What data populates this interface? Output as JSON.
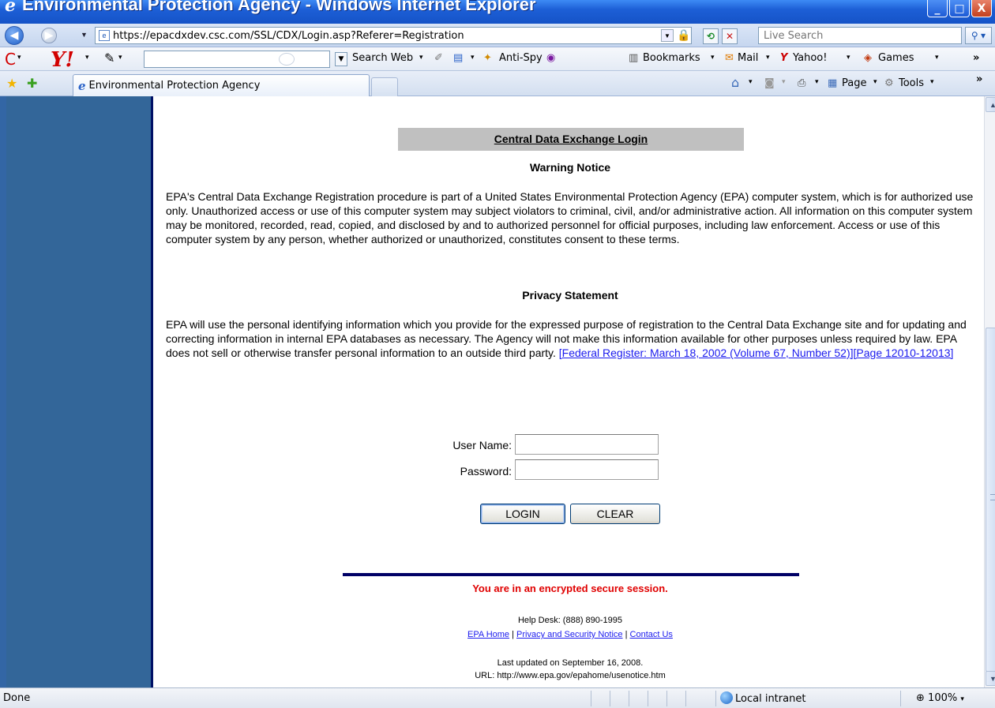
{
  "window": {
    "title": "Environmental Protection Agency - Windows Internet Explorer",
    "buttons": {
      "minimize": "_",
      "maximize": "□",
      "close": "X"
    }
  },
  "address_bar": {
    "url": "https://epacdxdev.csc.com/SSL/CDX/Login.asp?Referer=Registration",
    "search_placeholder": "Live Search"
  },
  "yahoo_toolbar": {
    "search_web_label": "Search Web",
    "anti_spy_label": "Anti-Spy",
    "bookmarks_label": "Bookmarks",
    "mail_label": "Mail",
    "yahoo_label": "Yahoo!",
    "games_label": "Games",
    "more": "»"
  },
  "tabs": {
    "active_label": "Environmental Protection Agency"
  },
  "command_bar": {
    "page_label": "Page",
    "tools_label": "Tools",
    "more": "»"
  },
  "page": {
    "header": "Central Data Exchange Login",
    "warning_title": "Warning Notice",
    "warning_text": "EPA's Central Data Exchange Registration procedure is part of a United States Environmental Protection Agency (EPA) computer system, which is for authorized use only. Unauthorized access or use of this computer system may subject violators to criminal, civil, and/or administrative action. All information on this computer system may be monitored, recorded, read, copied, and disclosed by and to authorized personnel for official purposes, including law enforcement. Access or use of this computer system by any person, whether authorized or unauthorized, constitutes consent to these terms.",
    "privacy_title": "Privacy Statement",
    "privacy_text": "EPA will use the personal identifying information which you provide for the expressed purpose of registration to the Central Data Exchange site and for updating and correcting information in internal EPA databases as necessary. The Agency will not make this information available for other purposes unless required by law. EPA does not sell or otherwise transfer personal information to an outside third party.",
    "privacy_link": "[Federal Register: March 18, 2002 (Volume 67, Number 52)][Page 12010-12013]",
    "username_label": "User Name:",
    "username_value": "",
    "password_label": "Password:",
    "password_value": "",
    "login_button": "LOGIN",
    "clear_button": "CLEAR",
    "secure_notice": "You are in an encrypted secure session.",
    "help_desk": "Help Desk: (888) 890-1995",
    "links": {
      "home": "EPA Home",
      "sep1": " | ",
      "privacy": "Privacy and Security Notice",
      "sep2": " | ",
      "contact": "Contact Us"
    },
    "last_updated": "Last updated on September 16, 2008.",
    "url_note": "URL: http://www.epa.gov/epahome/usenotice.htm"
  },
  "status_bar": {
    "status": "Done",
    "zone": "Local intranet",
    "zoom": "100%"
  }
}
